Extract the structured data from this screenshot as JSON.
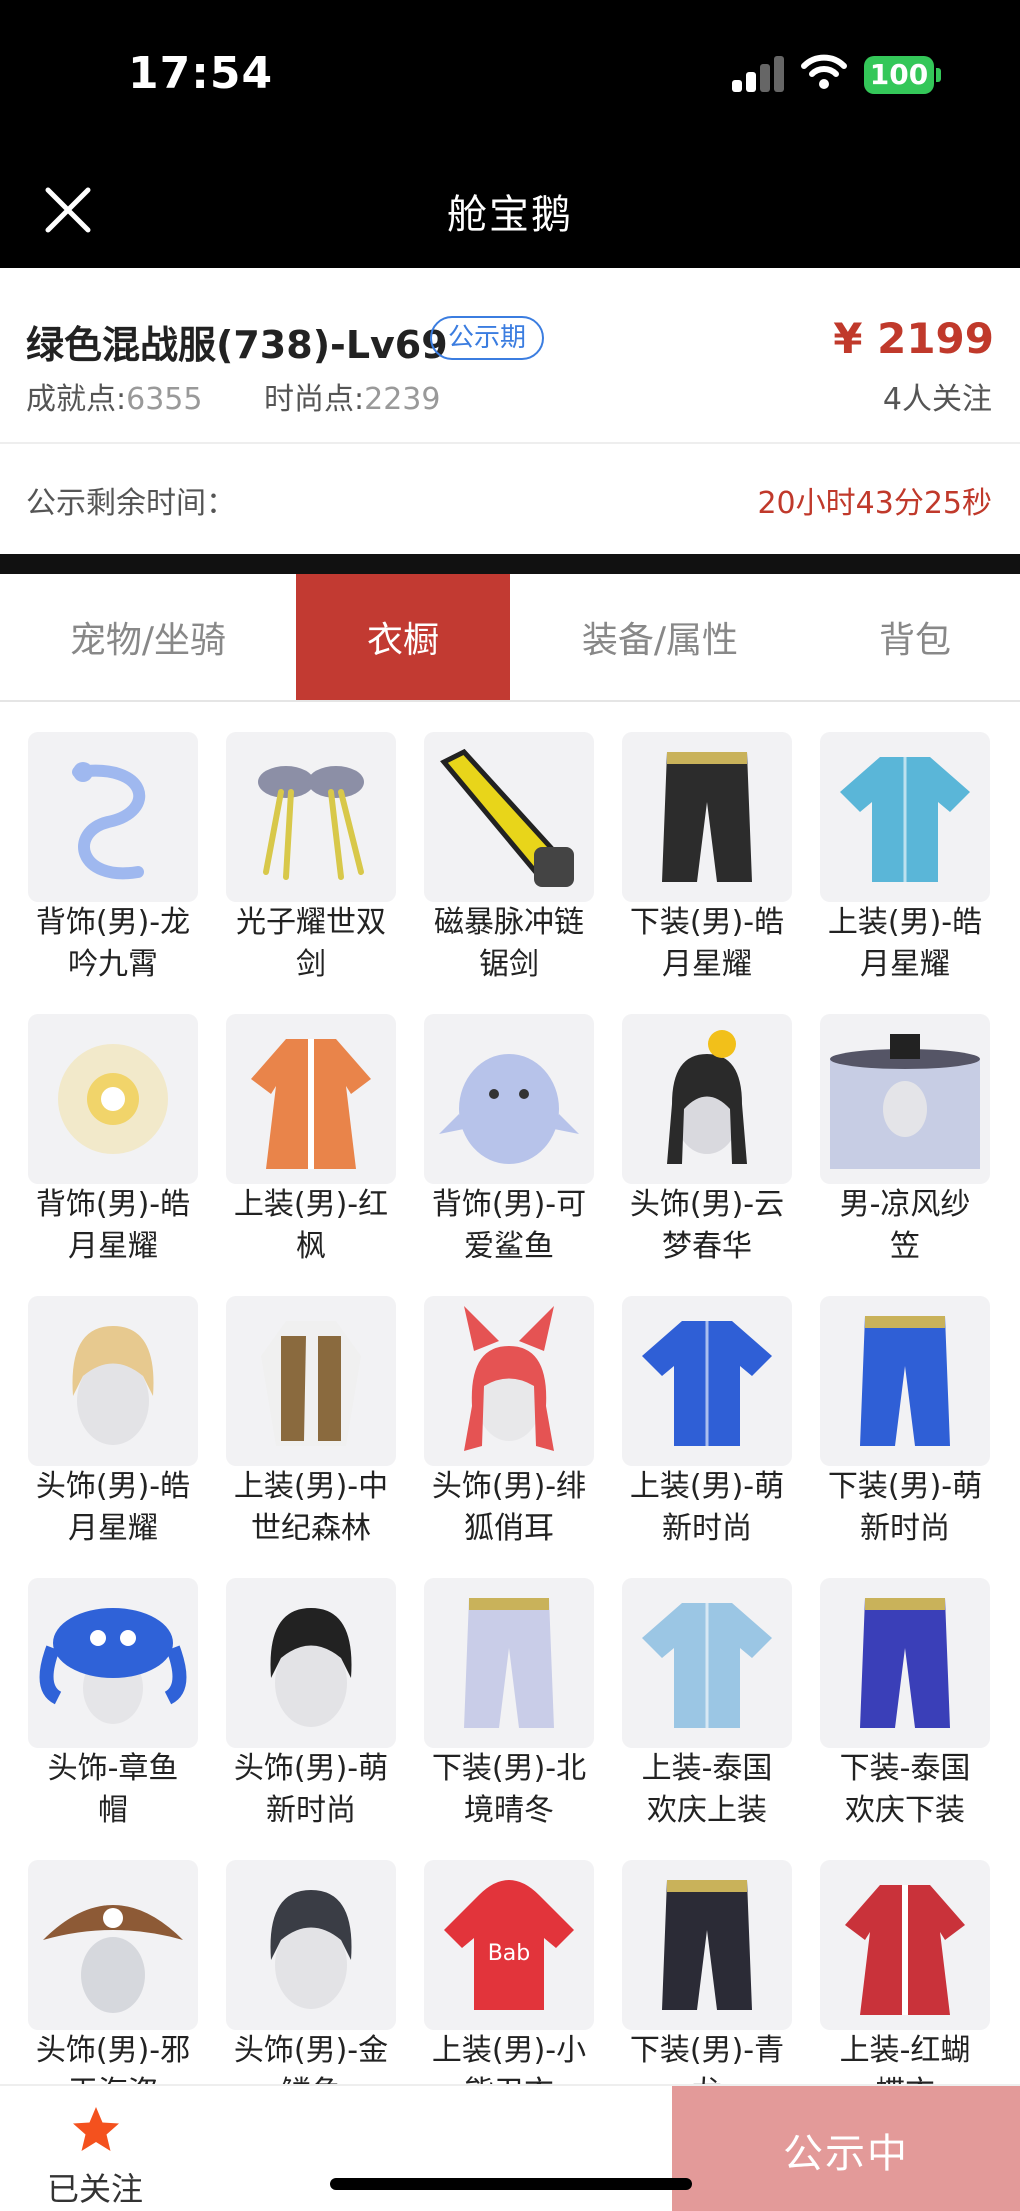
{
  "status_bar": {
    "time": "17:54",
    "battery": "100"
  },
  "nav": {
    "title": "舱宝鹅"
  },
  "item": {
    "title": "绿色混战服(738)-Lv69",
    "badge": "公示期",
    "price": "¥ 2199",
    "followers": "4人关注",
    "achievement_label": "成就点:",
    "achievement_value": "6355",
    "fashion_label": "时尚点:",
    "fashion_value": "2239",
    "remaining_label": "公示剩余时间：",
    "remaining_value": "20小时43分25秒"
  },
  "tabs": [
    {
      "label": "宠物/坐骑",
      "active": false
    },
    {
      "label": "衣橱",
      "active": true
    },
    {
      "label": "装备/属性",
      "active": false
    },
    {
      "label": "背包",
      "active": false
    }
  ],
  "wardrobe": [
    {
      "line1": "背饰(男)-龙",
      "line2": "吟九霄",
      "icon": "dragon-icon",
      "color": "#9fb8ef"
    },
    {
      "line1": "光子耀世双",
      "line2": "剑",
      "icon": "twin-sword-icon",
      "color": "#d8c84a"
    },
    {
      "line1": "磁暴脉冲链",
      "line2": "锯剑",
      "icon": "chainsaw-sword-icon",
      "color": "#e8d51a"
    },
    {
      "line1": "下装(男)-皓",
      "line2": "月星耀",
      "icon": "pants-icon",
      "color": "#2c2c2c"
    },
    {
      "line1": "上装(男)-皓",
      "line2": "月星耀",
      "icon": "jacket-icon",
      "color": "#5ab6d8"
    },
    {
      "line1": "背饰(男)-皓",
      "line2": "月星耀",
      "icon": "orb-icon",
      "color": "#f1d46a"
    },
    {
      "line1": "上装(男)-红",
      "line2": "枫",
      "icon": "robe-icon",
      "color": "#e9844a"
    },
    {
      "line1": "背饰(男)-可",
      "line2": "爱鲨鱼",
      "icon": "shark-icon",
      "color": "#b7c3ea"
    },
    {
      "line1": "头饰(男)-云",
      "line2": "梦春华",
      "icon": "hairpiece-icon",
      "color": "#2a2a2a"
    },
    {
      "line1": "男-凉风纱",
      "line2": "笠",
      "icon": "veil-hat-icon",
      "color": "#aab4d8"
    },
    {
      "line1": "头饰(男)-皓",
      "line2": "月星耀",
      "icon": "hair-icon",
      "color": "#e7c98f"
    },
    {
      "line1": "上装(男)-中",
      "line2": "世纪森林",
      "icon": "vest-icon",
      "color": "#8a6a3e"
    },
    {
      "line1": "头饰(男)-绯",
      "line2": "狐俏耳",
      "icon": "fox-ears-icon",
      "color": "#e55353"
    },
    {
      "line1": "上装(男)-萌",
      "line2": "新时尚",
      "icon": "jacket-icon",
      "color": "#2f5fd6"
    },
    {
      "line1": "下装(男)-萌",
      "line2": "新时尚",
      "icon": "pants-icon",
      "color": "#2f5fd6"
    },
    {
      "line1": "头饰-章鱼",
      "line2": "帽",
      "icon": "octopus-hat-icon",
      "color": "#2f62d8"
    },
    {
      "line1": "头饰(男)-萌",
      "line2": "新时尚",
      "icon": "hair-icon",
      "color": "#222222"
    },
    {
      "line1": "下装(男)-北",
      "line2": "境晴冬",
      "icon": "pants-icon",
      "color": "#c9cde8"
    },
    {
      "line1": "上装-泰国",
      "line2": "欢庆上装",
      "icon": "shirt-icon",
      "color": "#9bc6e4"
    },
    {
      "line1": "下装-泰国",
      "line2": "欢庆下装",
      "icon": "pants-icon",
      "color": "#3a3fb8"
    },
    {
      "line1": "头饰(男)-邪",
      "line2": "王海盗",
      "icon": "pirate-hat-icon",
      "color": "#8d5a36"
    },
    {
      "line1": "头饰(男)-金",
      "line2": "鳞角",
      "icon": "hair-icon",
      "color": "#3a3d45"
    },
    {
      "line1": "上装(男)-小",
      "line2": "熊卫衣",
      "icon": "hoodie-icon",
      "color": "#e2343b"
    },
    {
      "line1": "下装(男)-青",
      "line2": "龙",
      "icon": "pants-icon",
      "color": "#2b2b36"
    },
    {
      "line1": "上装-红蝴",
      "line2": "蝶衣",
      "icon": "robe-icon",
      "color": "#c9323a"
    }
  ],
  "bottom": {
    "follow_label": "已关注",
    "status_label": "公示中"
  },
  "colors": {
    "accent": "#c23a32",
    "price": "#c0392b",
    "badge": "#3b7de0",
    "status_button": "#e39a99",
    "star": "#f4511e"
  }
}
